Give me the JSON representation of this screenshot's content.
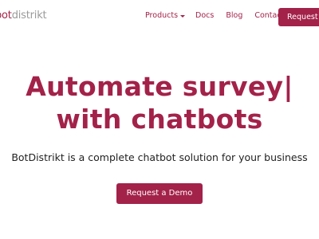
{
  "brand": {
    "logo_prefix": "bot",
    "logo_suffix": "distrikt",
    "accent_color": "#a3224a"
  },
  "nav": {
    "products": "Products",
    "docs": "Docs",
    "blog": "Blog",
    "contact": "Contact",
    "cta": "Request a Demo"
  },
  "hero": {
    "title_line1": "Automate survey|",
    "title_line2": "with chatbots",
    "subtitle": "BotDistrikt is a complete chatbot solution for your business",
    "cta": "Request a Demo"
  }
}
